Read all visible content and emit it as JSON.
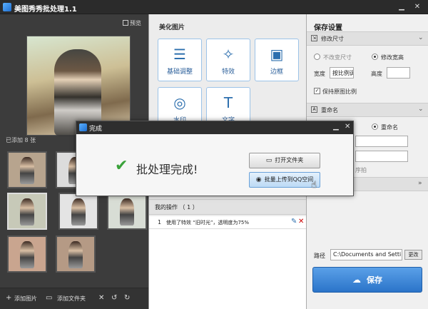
{
  "window": {
    "title": "美图秀秀批处理1.1"
  },
  "left": {
    "preview_label": "预览",
    "added_label": "已添加 8 张",
    "bottom": {
      "add_image": "添加图片",
      "add_folder": "添加文件夹"
    }
  },
  "middle": {
    "section_title": "美化图片",
    "tools": [
      {
        "label": "基础调整",
        "icon": "sliders-icon"
      },
      {
        "label": "特效",
        "icon": "magic-wand-icon"
      },
      {
        "label": "边框",
        "icon": "frame-icon"
      },
      {
        "label": "水印",
        "icon": "watermark-icon"
      },
      {
        "label": "文字",
        "icon": "text-icon"
      }
    ],
    "ops_header": "我的操作 （ 1 ）",
    "ops": [
      {
        "num": "1",
        "text": "使用了特效 “旧时光”，透明度为75%"
      }
    ]
  },
  "right": {
    "head": "保存设置",
    "resize_section": "修改尺寸",
    "no_resize": "不改变尺寸",
    "resize_wh": "修改宽高",
    "width_label": "宽度",
    "width_value": "按比例调",
    "height_label": "高度",
    "height_value": "",
    "keep_ratio": "保持原图比例",
    "rename_section": "重命名",
    "rename_option": "重命名",
    "partial_text": "序拍",
    "path_label": "路径",
    "path_value": "C:\\Documents and Setti",
    "change_label": "更改",
    "save_label": "保存"
  },
  "dialog": {
    "title": "完成",
    "message": "批处理完成!",
    "open_folder": "打开文件夹",
    "upload_qq": "批量上传到QQ空间"
  },
  "colors": {
    "accent": "#2b74c9",
    "success": "#3aa23a",
    "dark": "#3a3a3a"
  }
}
